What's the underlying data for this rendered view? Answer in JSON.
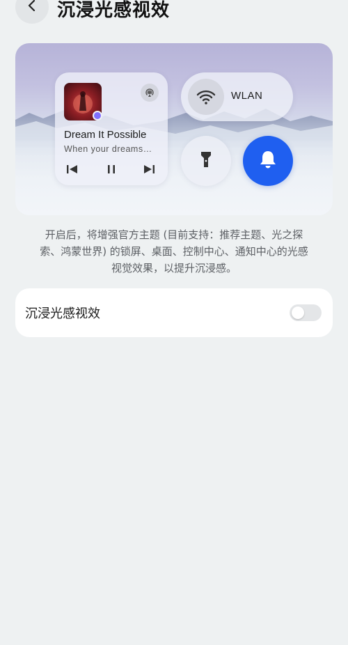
{
  "header": {
    "title": "沉浸光感视效",
    "back_icon": "chevron-left-icon"
  },
  "preview": {
    "music": {
      "song_title": "Dream It Possible",
      "song_subtitle": "When your dreams…",
      "controls": [
        "skip-previous-icon",
        "pause-icon",
        "skip-next-icon"
      ],
      "cast_icon": "audio-cast-icon"
    },
    "wlan": {
      "label": "WLAN",
      "icon": "wifi-icon"
    },
    "flashlight_icon": "flashlight-icon",
    "bell_icon": "bell-icon",
    "accent_color": "#1f5ff0"
  },
  "description": {
    "line1": "开启后，将增强官方主题 (目前支持：推荐主题、光之探",
    "line2": "索、鸿蒙世界) 的锁屏、桌面、控制中心、通知中心的光感",
    "line3": "视觉效果，以提升沉浸感。"
  },
  "setting": {
    "label": "沉浸光感视效",
    "toggle_on": false
  }
}
